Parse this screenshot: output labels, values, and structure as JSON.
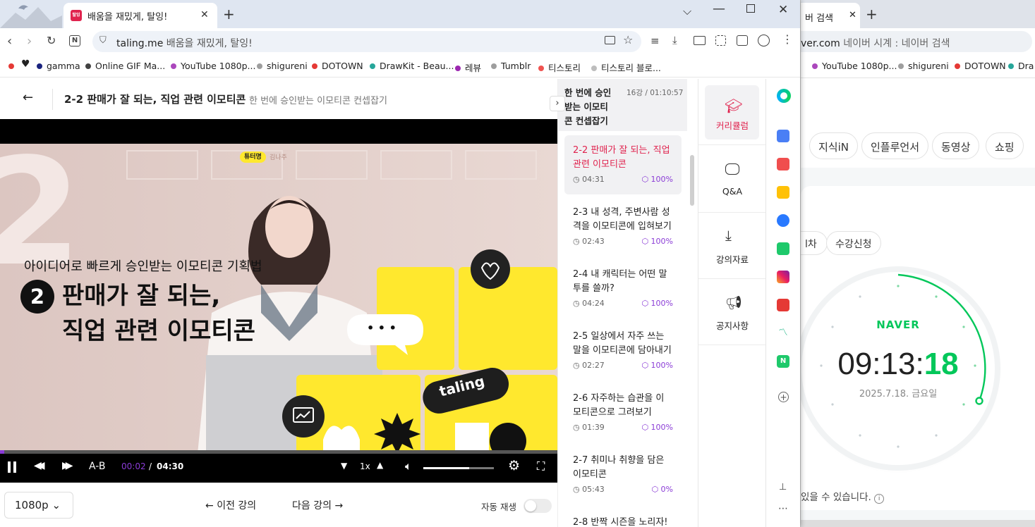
{
  "front_browser": {
    "tab_title": "배움을 재밌게, 탈잉!",
    "tab_favicon_text": "탈잉",
    "url_host": "taling.me",
    "url_title": "배움을 재밌게, 탈잉!",
    "bookmarks": [
      "gamma",
      "Online GIF Ma...",
      "YouTube 1080p...",
      "shigureni",
      "DOTOWN",
      "DrawKit - Beau...",
      "레뷰",
      "Tumblr",
      "티스토리",
      "티스토리 블로..."
    ],
    "bookmark_colors": [
      "#e53935",
      "#222222",
      "#1a237e",
      "#424242",
      "#ab47bc",
      "#9e9e9e",
      "#e53935",
      "#26a69a",
      "#9c27b0",
      "#9e9e9e",
      "#ef5350",
      "#bdbdbd"
    ]
  },
  "page": {
    "title": "2-2 판매가 잘 되는, 직업 관련 이모티콘",
    "subtitle": "한 번에 승인받는 이모티콘 컨셉잡기"
  },
  "video": {
    "tag": "튜터명",
    "tag_name": "김나주",
    "caption_small": "아이디어로 빠르게 승인받는 이모티콘 기획법",
    "caption_num": "2",
    "caption_line1": "판매가 잘 되는,",
    "caption_line2": "직업 관련 이모티콘",
    "sticker_text": "taling",
    "bubble": "• • •",
    "ab_label": "A-B",
    "current_time": "00:02",
    "time_sep": "/",
    "duration": "04:30",
    "speed": "1x",
    "progress": 0.007,
    "volume": 0.65,
    "quality": "1080p"
  },
  "nav": {
    "prev": "이전 강의",
    "next": "다음 강의",
    "autoplay": "자동 재생",
    "autoplay_on": false
  },
  "curriculum": {
    "title": "한 번에 승인받는 이모티콘 컨셉잡기",
    "title_lines": [
      "한 번에 승인",
      "받는 이모티",
      "콘 컨셉잡기"
    ],
    "meta": "16강 / 01:10:57",
    "lessons": [
      {
        "title_lines": [
          "2-2 판매가 잘 되는, 직업",
          "관련 이모티콘"
        ],
        "time": "04:31",
        "progress": "100%",
        "active": true
      },
      {
        "title_lines": [
          "2-3 내 성격, 주변사람 성",
          "격을 이모티콘에 입혀보기"
        ],
        "time": "02:43",
        "progress": "100%",
        "active": false
      },
      {
        "title_lines": [
          "2-4 내 캐릭터는 어떤 말",
          "투를 쓸까?"
        ],
        "time": "04:24",
        "progress": "100%",
        "active": false
      },
      {
        "title_lines": [
          "2-5 일상에서 자주 쓰는",
          "말을 이모티콘에 담아내기"
        ],
        "time": "02:27",
        "progress": "100%",
        "active": false
      },
      {
        "title_lines": [
          "2-6 자주하는 습관을 이",
          "모티콘으로 그려보기"
        ],
        "time": "01:39",
        "progress": "100%",
        "active": false
      },
      {
        "title_lines": [
          "2-7 취미나 취향을 담은",
          "이모티콘"
        ],
        "time": "05:43",
        "progress": "0%",
        "active": false
      },
      {
        "title_lines": [
          "2-8 반짝 시즌을 노리자!"
        ],
        "time": "",
        "progress": "",
        "active": false
      }
    ]
  },
  "rail": {
    "items": [
      {
        "label": "커리큘럼",
        "icon": "graduation-cap-icon",
        "active": true
      },
      {
        "label": "Q&A",
        "icon": "chat-bubble-icon",
        "active": false
      },
      {
        "label": "강의자료",
        "icon": "download-icon",
        "active": false
      },
      {
        "label": "공지사항",
        "icon": "megaphone-icon",
        "active": false
      }
    ]
  },
  "naver_window": {
    "tab_title": "버 검색",
    "url_host": "ver.com",
    "url_title": "네이버 시계 : 네이버 검색",
    "bookmarks": [
      "YouTube 1080p...",
      "shigureni",
      "DOTOWN",
      "Dra"
    ],
    "search_tabs": [
      "지식iN",
      "인플루언서",
      "동영상",
      "쇼핑"
    ],
    "sub_tabs": [
      "l차",
      "수강신청"
    ],
    "clock_brand": "NAVER",
    "clock_hm": "09:13:",
    "clock_sec": "18",
    "clock_date": "2025.7.18. 금요일",
    "footer_text": "있을 수 있습니다.",
    "brand_color": "#03c75a"
  },
  "colors": {
    "accent": "#e0234e",
    "purple": "#8a3bd6",
    "yellow": "#ffe82e"
  }
}
